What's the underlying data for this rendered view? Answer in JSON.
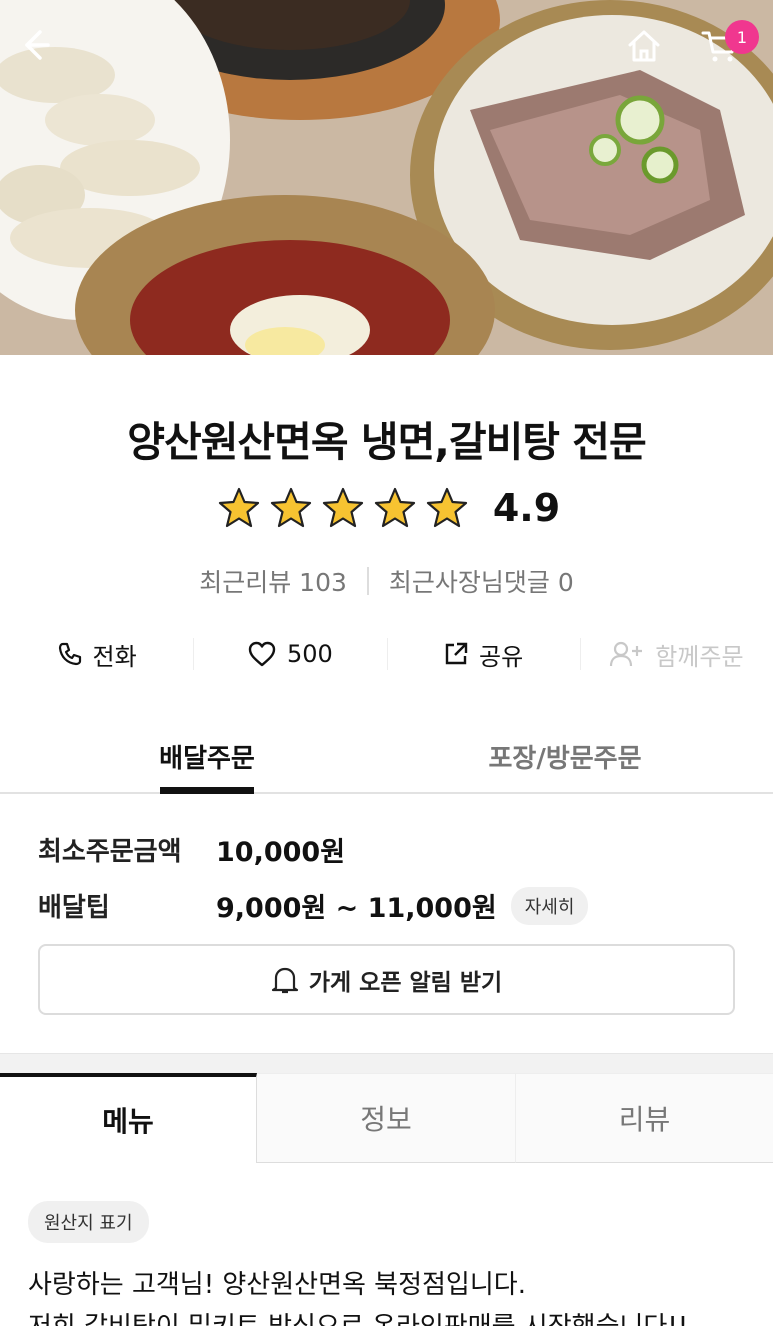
{
  "header": {
    "cart_count": "1",
    "back_icon": "chevron-left-icon",
    "home_icon": "home-icon",
    "cart_icon": "cart-icon",
    "badge_color": "#f0378f"
  },
  "store": {
    "name": "양산원산면옥 냉면,갈비탕 전문",
    "rating": "4.9",
    "stars": 5,
    "recent_reviews": "최근리뷰 103",
    "owner_replies": "최근사장님댓글 0"
  },
  "actions": {
    "call": "전화",
    "likes": "500",
    "share": "공유",
    "group_order": "함께주문"
  },
  "order_tabs": {
    "delivery": "배달주문",
    "pickup": "포장/방문주문"
  },
  "order_info": {
    "min_order_label": "최소주문금액",
    "min_order_value": "10,000원",
    "delivery_tip_label": "배달팁",
    "delivery_tip_value": "9,000원 ~ 11,000원",
    "detail_label": "자세히",
    "notify_label": "가게 오픈 알림 받기"
  },
  "main_tabs": {
    "menu": "메뉴",
    "info": "정보",
    "review": "리뷰"
  },
  "menu": {
    "origin_chip": "원산지 표기",
    "notice_line1": "사랑하는 고객님! 양산원산면옥 북정점입니다.",
    "notice_line2": "저희 갈비탕이 밀키트 방식으로 온라인판매를 시작했습니다!!"
  }
}
